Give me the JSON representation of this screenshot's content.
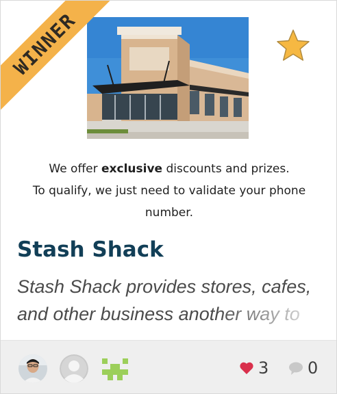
{
  "ribbon": {
    "label": "WINNER",
    "color": "#f4b24a"
  },
  "favorite": {
    "icon": "star-icon",
    "color": "#f6b842"
  },
  "hero": {
    "icon": "storefront-building-image"
  },
  "offer": {
    "line1_prefix": "We offer ",
    "line1_bold": "exclusive",
    "line1_suffix": " discounts and prizes.",
    "line2": "To qualify, we just need to validate your phone number."
  },
  "title": "Stash Shack",
  "description": "Stash Shack provides stores, cafes, and other business another way to",
  "footer": {
    "avatars": [
      {
        "name": "user-photo-avatar",
        "icon": "person-photo"
      },
      {
        "name": "default-user-avatar",
        "icon": "user-silhouette-icon"
      },
      {
        "name": "identicon-avatar",
        "icon": "identicon-icon"
      }
    ],
    "likes": {
      "icon": "heart-icon",
      "count": "3",
      "color": "#d9304c"
    },
    "comments": {
      "icon": "comment-bubble-icon",
      "count": "0",
      "color": "#c8c8c8"
    }
  }
}
